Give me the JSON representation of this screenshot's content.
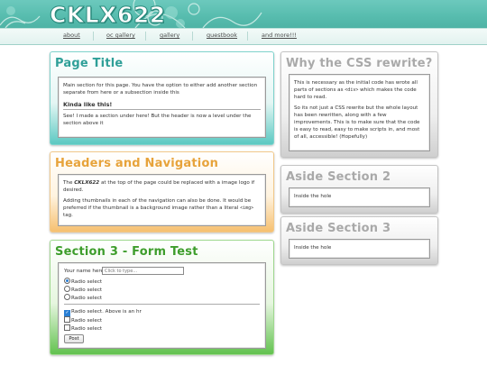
{
  "site": {
    "logo": "CKLX622"
  },
  "nav": [
    "about",
    "oc gallery",
    "gallery",
    "guestbook",
    "and more!!!"
  ],
  "colors": {
    "teal": "#5cc9c2",
    "orange": "#f6c070",
    "green": "#62c24f",
    "gray": "#cfcfcf",
    "header": "#57bcae"
  },
  "page_title": {
    "title": "Page Title",
    "body": "Main section for this page. You have the option to either add another section separate from here or a subsection inside this",
    "subtitle": "Kinda like this!",
    "sub_body": "See! I made a section under here! But the header is now a level under the section above it"
  },
  "headers_nav": {
    "title": "Headers and Navigation",
    "p1_prefix": "The ",
    "p1_em": "CKLX622",
    "p1_suffix": " at the top of the page could be replaced with a image logo if desired.",
    "p2_prefix": "Adding thumbnails in each of the navigation can also be done. It would be preferred if the thumbnail is a background image rather than a literal ",
    "p2_code": "<img>",
    "p2_suffix": " tag."
  },
  "form_test": {
    "title": "Section 3 - Form Test",
    "name_label": "Your name here:",
    "name_placeholder": "Click to type...",
    "radios": [
      "Radio select",
      "Radio select",
      "Radio select"
    ],
    "checks": [
      "Radio select. Above is an hr",
      "Radio select",
      "Radio select"
    ],
    "post_label": "Post"
  },
  "css_rewrite": {
    "title": "Why the CSS rewrite?",
    "p1_prefix": "This is necessary as the initial code has wrote all parts of sections as ",
    "p1_code": "<div>",
    "p1_suffix": " which makes the code hard to read.",
    "p2": "So its not just a CSS rewrite but the whole layout has been rewritten, along with a few improvements. This is to make sure that the code is easy to read, easy to make scripts in, and most of all, accessible! (Hopefully)"
  },
  "aside2": {
    "title": "Aside Section 2",
    "body": "Inside the hole"
  },
  "aside3": {
    "title": "Aside Section 3",
    "body": "Inside the hole"
  }
}
